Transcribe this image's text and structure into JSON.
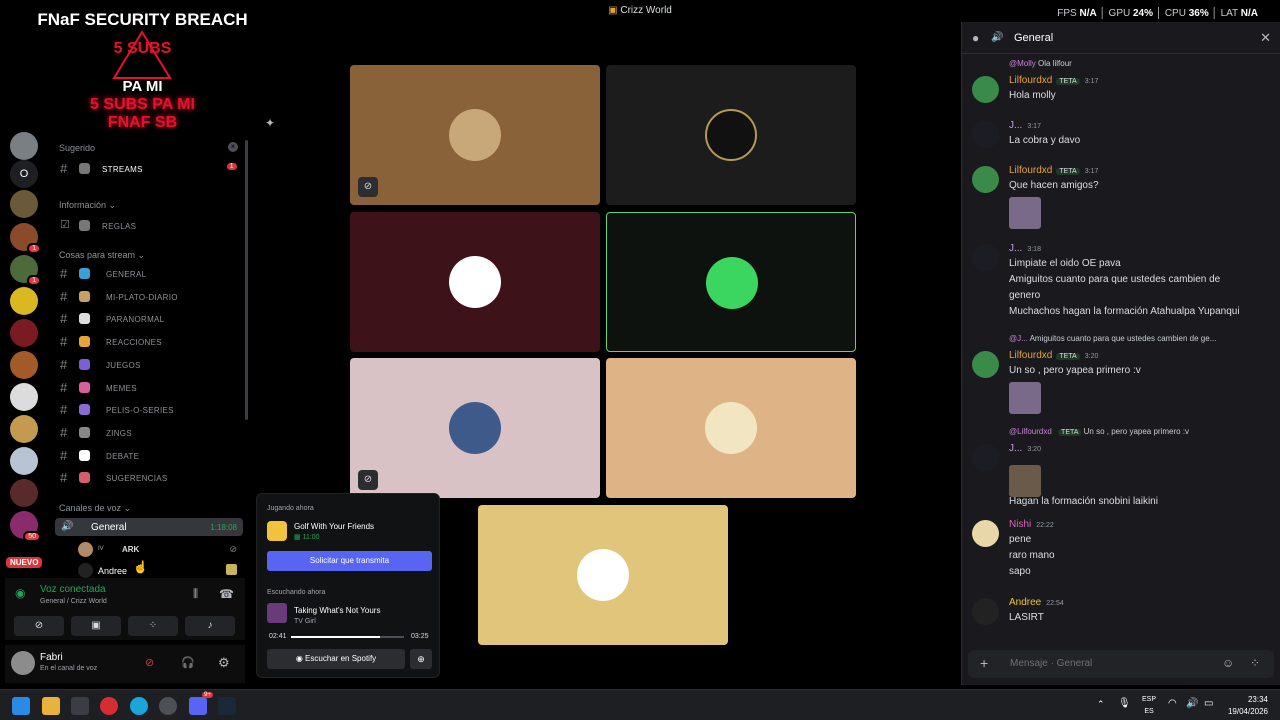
{
  "window": {
    "title": "Crizz World"
  },
  "perf": {
    "fps_label": "FPS",
    "fps": "N/A",
    "gpu_label": "GPU",
    "gpu": "24%",
    "cpu_label": "CPU",
    "cpu": "36%",
    "lat_label": "LAT",
    "lat": "N/A"
  },
  "overlay": {
    "title": "FNaF SECURITY BREACH",
    "badge": "5 SUBS",
    "pami": "PA MI",
    "line1": "5 SUBS PA MI",
    "line2": "FNAF SB"
  },
  "rail": {
    "badges": [
      "1",
      "1",
      "1",
      "50"
    ],
    "new_label": "NUEVO",
    "letter": "O"
  },
  "channels": {
    "suggested_label": "Sugerido",
    "streams": {
      "name": "STREAMS",
      "badge": "1"
    },
    "info_label": "Información",
    "reglas": "REGLAS",
    "stream_label": "Cosas para stream",
    "list": [
      "GENERAL",
      "MI-PLATO-DIARIO",
      "PARANORMAL",
      "REACCIONES",
      "JUEGOS",
      "MEMES",
      "PELIS-O-SERIES",
      "ZINGS",
      "DEBATE",
      "SUGERENCIAS"
    ],
    "voice_label": "Canales de voz",
    "voice_channel": "General",
    "voice_time": "1:18:08",
    "voice_users": [
      {
        "prefix": "IV",
        "name": "ARK"
      },
      {
        "prefix": "",
        "name": "Andree"
      }
    ]
  },
  "voice_panel": {
    "status": "Voz conectada",
    "location": "General / Crizz World"
  },
  "user_panel": {
    "name": "Fabri",
    "status": "En el canal de voz"
  },
  "activity": {
    "playing_label": "Jugando ahora",
    "game": "Golf With Your Friends",
    "game_time": "11:00",
    "stream_button": "Solicitar que transmita",
    "listening_label": "Escuchando ahora",
    "song": "Taking What's Not Yours",
    "artist": "TV Girl",
    "elapsed": "02:41",
    "duration": "03:25",
    "progress": 0.79,
    "spotify_button": "Escuchar en Spotify"
  },
  "chat": {
    "channel": "General",
    "input_placeholder": "Mensaje · General",
    "messages": [
      {
        "reply_user": "@Molly",
        "reply_text": "Ola lilfour",
        "author": "Lilfourdxd",
        "tag": "TETA",
        "time": "3:17",
        "lines": [
          "Hola molly"
        ]
      },
      {
        "author": "J...",
        "time": "3:17",
        "lines": [
          "La cobra y davo"
        ]
      },
      {
        "author": "Lilfourdxd",
        "tag": "TETA",
        "time": "3:17",
        "lines": [
          "Que hacen amigos?"
        ]
      },
      {
        "author": "J...",
        "time": "3:18",
        "lines": [
          "Limpiate el oido OE pava",
          "Amiguitos cuanto para que ustedes cambien de",
          "genero",
          "Muchachos hagan la formación Atahualpa Yupanqui"
        ]
      },
      {
        "reply_user": "@J...",
        "reply_text": "Amiguitos cuanto para que ustedes cambien de ge...",
        "author": "Lilfourdxd",
        "tag": "TETA",
        "time": "3:20",
        "lines": [
          "Un so , pero yapea primero :v"
        ]
      },
      {
        "reply_user": "@Lilfourdxd",
        "reply_tag": "TETA",
        "reply_text": "Un so , pero yapea primero :v",
        "author": "J...",
        "time": "3:20",
        "lines": [
          "Hagan la formación snobini laikini"
        ]
      },
      {
        "author": "Nishi",
        "time": "22:22",
        "lines": [
          "pene",
          "raro mano",
          "sapo"
        ]
      },
      {
        "author": "Andree",
        "time": "22:54",
        "lines": [
          "LASIRT"
        ]
      }
    ]
  },
  "taskbar": {
    "lang1": "ESP",
    "lang2": "ES",
    "time": "23:34",
    "date": "19/04/2026",
    "badge": "9+"
  }
}
